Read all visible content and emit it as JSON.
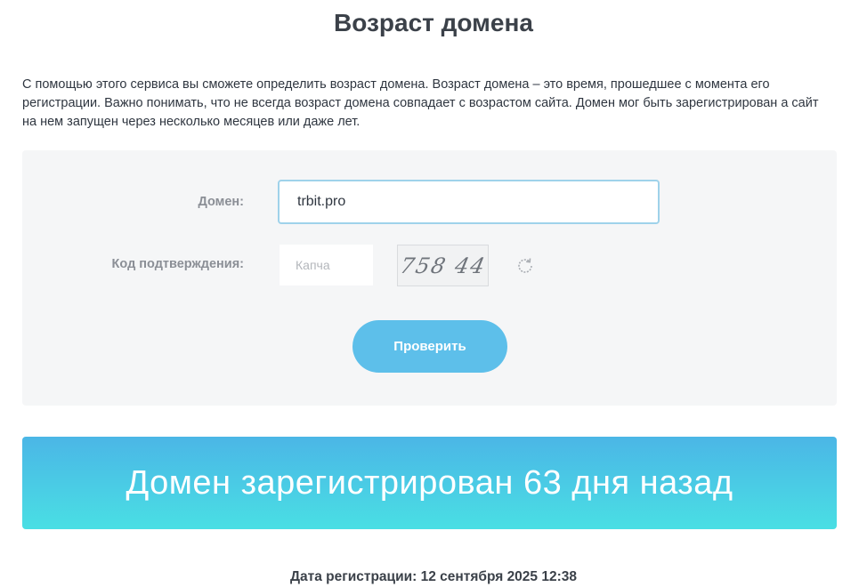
{
  "page": {
    "title": "Возраст домена",
    "intro_text": "С помощью этого сервиса вы сможете определить возраст домена. Возраст домена – это время, прошедшее с момента его регистрации. Важно понимать, что не всегда возраст домена совпадает с возрастом сайта. Домен мог быть зарегистрирован а сайт на нем запущен через несколько месяцев или даже лет."
  },
  "form": {
    "domain_label": "Домен:",
    "domain_value": "trbit.pro",
    "code_label": "Код подтверждения:",
    "captcha_placeholder": "Капча",
    "captcha_image_text": "758 44",
    "refresh_icon": "refresh-icon",
    "submit_label": "Проверить"
  },
  "result": {
    "banner_text": "Домен зарегистрирован 63 дня назад",
    "registration_date": "Дата регистрации: 12 сентября 2025 12:38"
  },
  "colors": {
    "button": "#5dbfea",
    "banner_top": "#4bb6e6",
    "banner_bottom": "#49dfe4",
    "input_border": "#9fd2ea"
  }
}
